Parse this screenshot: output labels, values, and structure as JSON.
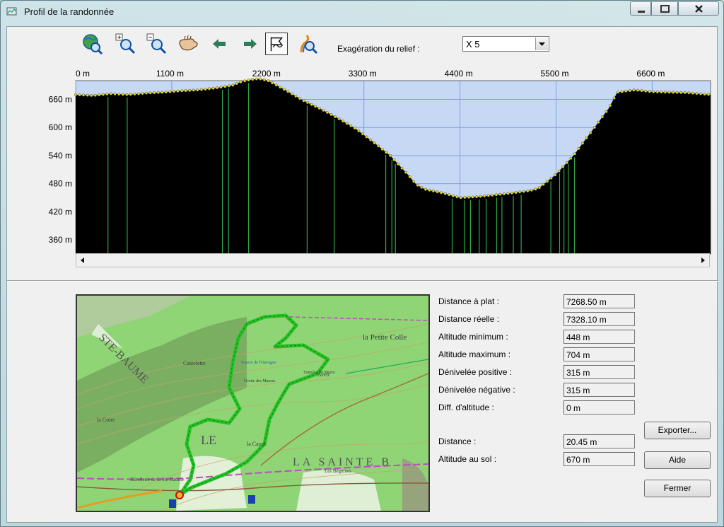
{
  "window": {
    "title": "Profil de la randonnée"
  },
  "toolbar": {
    "buttons": [
      {
        "name": "globe-zoom-icon"
      },
      {
        "name": "zoom-in-icon"
      },
      {
        "name": "zoom-out-icon"
      },
      {
        "name": "pan-hand-icon"
      },
      {
        "name": "arrow-left-icon"
      },
      {
        "name": "arrow-right-icon"
      },
      {
        "name": "profile-flag-icon"
      },
      {
        "name": "route-zoom-icon"
      }
    ],
    "relief_label": "Exagération du relief :",
    "relief_value": "X 5"
  },
  "chart_data": {
    "type": "area",
    "xlim": [
      0,
      7268.5
    ],
    "ylim": [
      330,
      700
    ],
    "x_ticks": [
      "0 m",
      "1100 m",
      "2200 m",
      "3300 m",
      "4400 m",
      "5500 m",
      "6600 m"
    ],
    "y_ticks": [
      "660 m",
      "600 m",
      "540 m",
      "480 m",
      "420 m",
      "360 m"
    ],
    "x": [
      0,
      200,
      400,
      600,
      800,
      1000,
      1200,
      1400,
      1600,
      1800,
      1900,
      2000,
      2100,
      2200,
      2300,
      2400,
      2600,
      2800,
      3000,
      3200,
      3400,
      3600,
      3800,
      3900,
      4000,
      4200,
      4400,
      4600,
      4800,
      5000,
      5200,
      5300,
      5500,
      5700,
      5900,
      6100,
      6200,
      6400,
      6600,
      6800,
      7000,
      7268.5
    ],
    "altitude": [
      670,
      668,
      672,
      670,
      673,
      675,
      678,
      680,
      684,
      690,
      698,
      702,
      704,
      700,
      690,
      680,
      658,
      640,
      620,
      598,
      570,
      540,
      500,
      478,
      468,
      460,
      450,
      452,
      456,
      460,
      465,
      470,
      500,
      540,
      590,
      640,
      675,
      680,
      676,
      675,
      674,
      670
    ],
    "waypoint_x": [
      370,
      590,
      1680,
      1750,
      1980,
      2650,
      2960,
      3550,
      3620,
      3660,
      4310,
      4450,
      4520,
      4620,
      4700,
      4820,
      4880,
      5010,
      5100,
      5440,
      5540,
      5590,
      5640,
      5710
    ]
  },
  "stats": [
    {
      "label": "Distance à plat :",
      "value": "7268.50 m"
    },
    {
      "label": "Distance réelle :",
      "value": "7328.10 m"
    },
    {
      "label": "Altitude minimum :",
      "value": "448 m"
    },
    {
      "label": "Altitude maximum :",
      "value": "704 m"
    },
    {
      "label": "Dénivelée positive :",
      "value": "315 m"
    },
    {
      "label": "Dénivelée négative :",
      "value": "315 m"
    },
    {
      "label": "Diff. d'altitude :",
      "value": "0 m"
    }
  ],
  "cursor": [
    {
      "label": "Distance :",
      "value": "20.45 m"
    },
    {
      "label": "Altitude au sol :",
      "value": "670 m"
    }
  ],
  "buttons": {
    "export": "Exporter...",
    "help": "Aide",
    "close": "Fermer"
  },
  "map": {
    "labels": [
      "STE-BAUME",
      "LE",
      "LA SAINTE B",
      "la Petite Colle",
      "Castelette",
      "la Coire",
      "la Cayre",
      "Aven",
      "Hôtellerie de la Ste-Baume",
      "Les Béguines",
      "Source de l'Ouvague",
      "Tumulus de Murre",
      "Grotte des Maures"
    ]
  },
  "colors": {
    "terrain": "#000000",
    "sky": "#c6d8f4",
    "grid": "#7f9fe0",
    "waypoint_line": "#2fa84a",
    "waypoint_dot": "#f0e020",
    "track": "#24c224",
    "map_green": "#8fd475"
  }
}
